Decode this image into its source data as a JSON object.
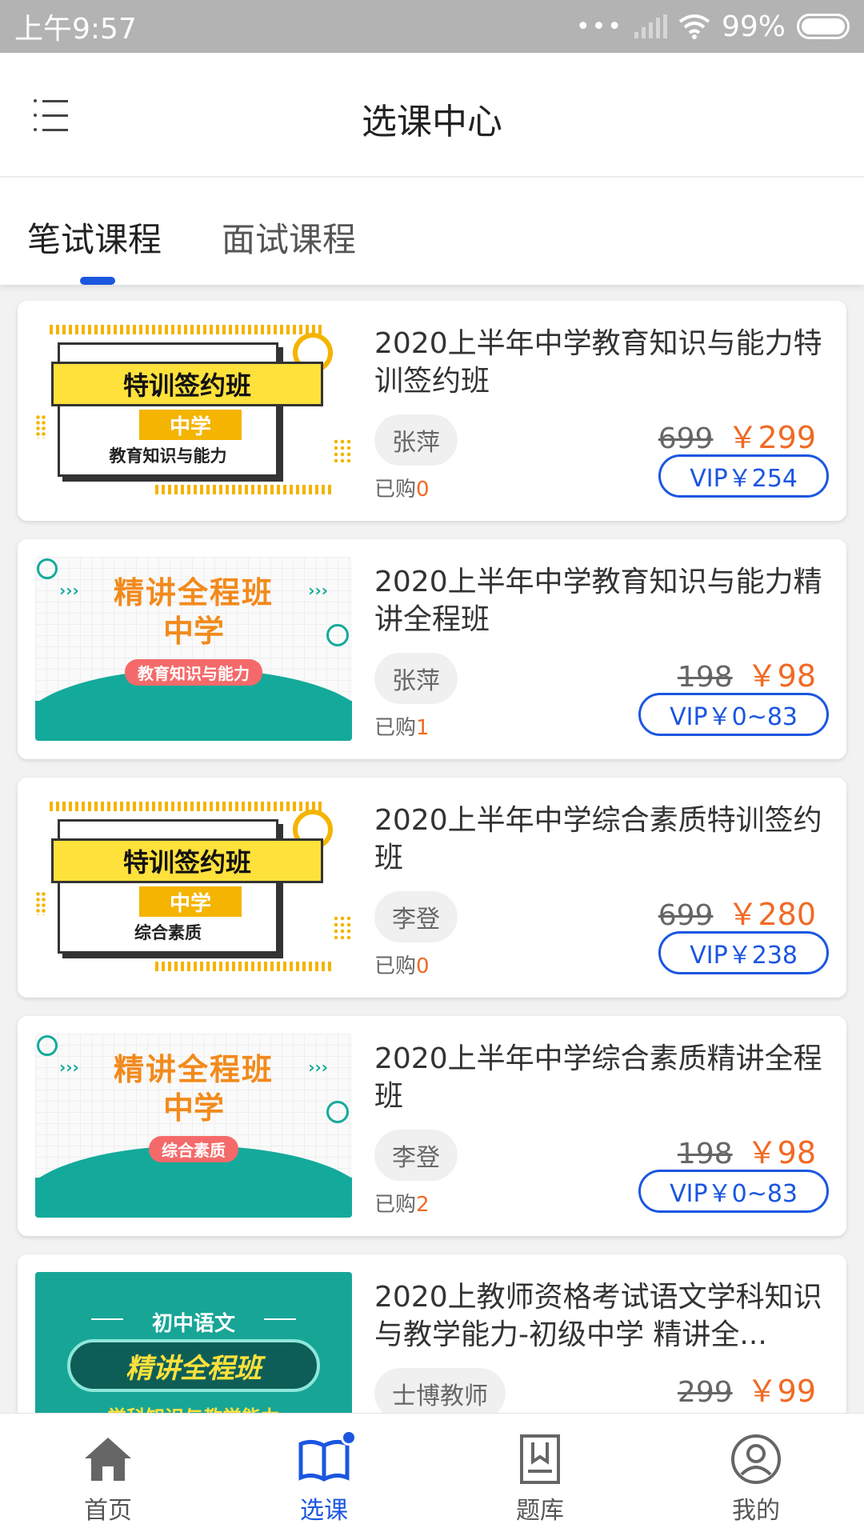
{
  "status": {
    "time": "上午9:57",
    "battery": "99%"
  },
  "header": {
    "title": "选课中心"
  },
  "tabs": [
    {
      "label": "笔试课程"
    },
    {
      "label": "面试课程"
    }
  ],
  "courses": [
    {
      "thumb_title": "特训签约班",
      "thumb_level": "中学",
      "thumb_subject": "教育知识与能力",
      "title": "2020上半年中学教育知识与能力特训签约班",
      "teacher": "张萍",
      "bought_label": "已购",
      "bought_count": "0",
      "original_price": "699",
      "price": "￥299",
      "vip_price": "VIP￥254"
    },
    {
      "thumb_title": "精讲全程班",
      "thumb_level": "中学",
      "thumb_subject": "教育知识与能力",
      "title": "2020上半年中学教育知识与能力精讲全程班",
      "teacher": "张萍",
      "bought_label": "已购",
      "bought_count": "1",
      "original_price": "198",
      "price": "￥98",
      "vip_price": "VIP￥0~83"
    },
    {
      "thumb_title": "特训签约班",
      "thumb_level": "中学",
      "thumb_subject": "综合素质",
      "title": "2020上半年中学综合素质特训签约班",
      "teacher": "李登",
      "bought_label": "已购",
      "bought_count": "0",
      "original_price": "699",
      "price": "￥280",
      "vip_price": "VIP￥238"
    },
    {
      "thumb_title": "精讲全程班",
      "thumb_level": "中学",
      "thumb_subject": "综合素质",
      "title": "2020上半年中学综合素质精讲全程班",
      "teacher": "李登",
      "bought_label": "已购",
      "bought_count": "2",
      "original_price": "198",
      "price": "￥98",
      "vip_price": "VIP￥0~83"
    },
    {
      "thumb_title": "精讲全程班",
      "thumb_level": "初中语文",
      "thumb_subject": "学科知识与教学能力",
      "title": "2020上教师资格考试语文学科知识与教学能力-初级中学 精讲全...",
      "teacher": "士博教师",
      "bought_label": "",
      "bought_count": "",
      "original_price": "299",
      "price": "￥99",
      "vip_price": ""
    }
  ],
  "bottom_nav": [
    {
      "label": "首页",
      "icon": "home-icon"
    },
    {
      "label": "选课",
      "icon": "book-icon"
    },
    {
      "label": "题库",
      "icon": "question-bank-icon"
    },
    {
      "label": "我的",
      "icon": "user-icon"
    }
  ],
  "colors": {
    "accent": "#1b56e0",
    "price": "#f06a24",
    "thumb_yellow": "#ffe13c",
    "thumb_teal": "#14aa9b"
  }
}
